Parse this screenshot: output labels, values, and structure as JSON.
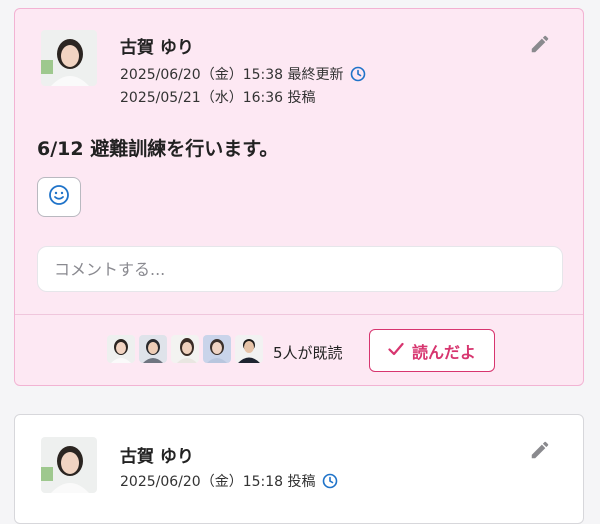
{
  "posts": [
    {
      "author": "古賀 ゆり",
      "updated": "2025/06/20（金）15:38 最終更新",
      "posted": "2025/05/21（水）16:36 投稿",
      "body": "6/12 避難訓練を行います。",
      "comment_placeholder": "コメントする...",
      "read_count": "5人が既読",
      "read_button": "読んだよ"
    },
    {
      "author": "古賀 ゆり",
      "posted": "2025/06/20（金）15:18 投稿"
    }
  ],
  "icons": {
    "edit": "pencil-icon",
    "clock": "clock-icon",
    "emoji": "smiley-icon",
    "check": "check-icon"
  },
  "colors": {
    "card_bg": "#fde8f3",
    "card_border": "#f2b3d3",
    "accent": "#d7356f",
    "icon_blue": "#1f73c9"
  }
}
